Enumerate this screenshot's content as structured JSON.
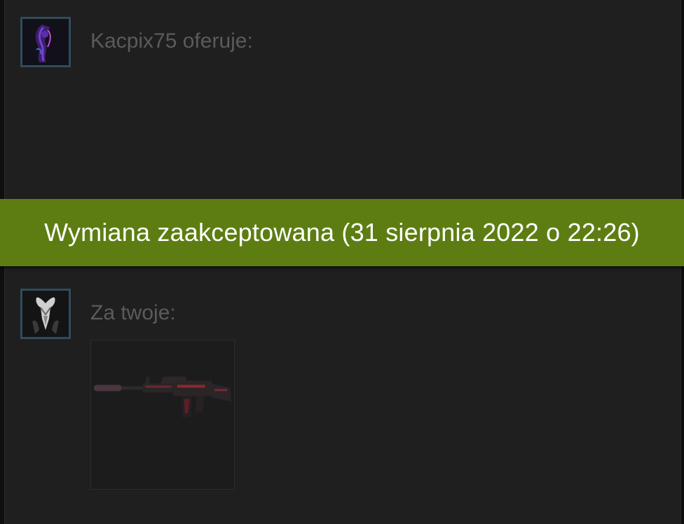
{
  "offer": {
    "partner_label": "Kacpix75 oferuje:",
    "partner_items": []
  },
  "status": {
    "banner_text": "Wymiana zaakceptowana (31 sierpnia 2022 o 22:26)",
    "color": "#5d7d12"
  },
  "yours": {
    "label": "Za twoje:",
    "items": [
      {
        "icon": "rifle-skin-icon"
      }
    ]
  },
  "colors": {
    "background": "#1f1f1f",
    "avatar_border": "#2f4b5c",
    "muted_text": "#5b5b5b"
  }
}
